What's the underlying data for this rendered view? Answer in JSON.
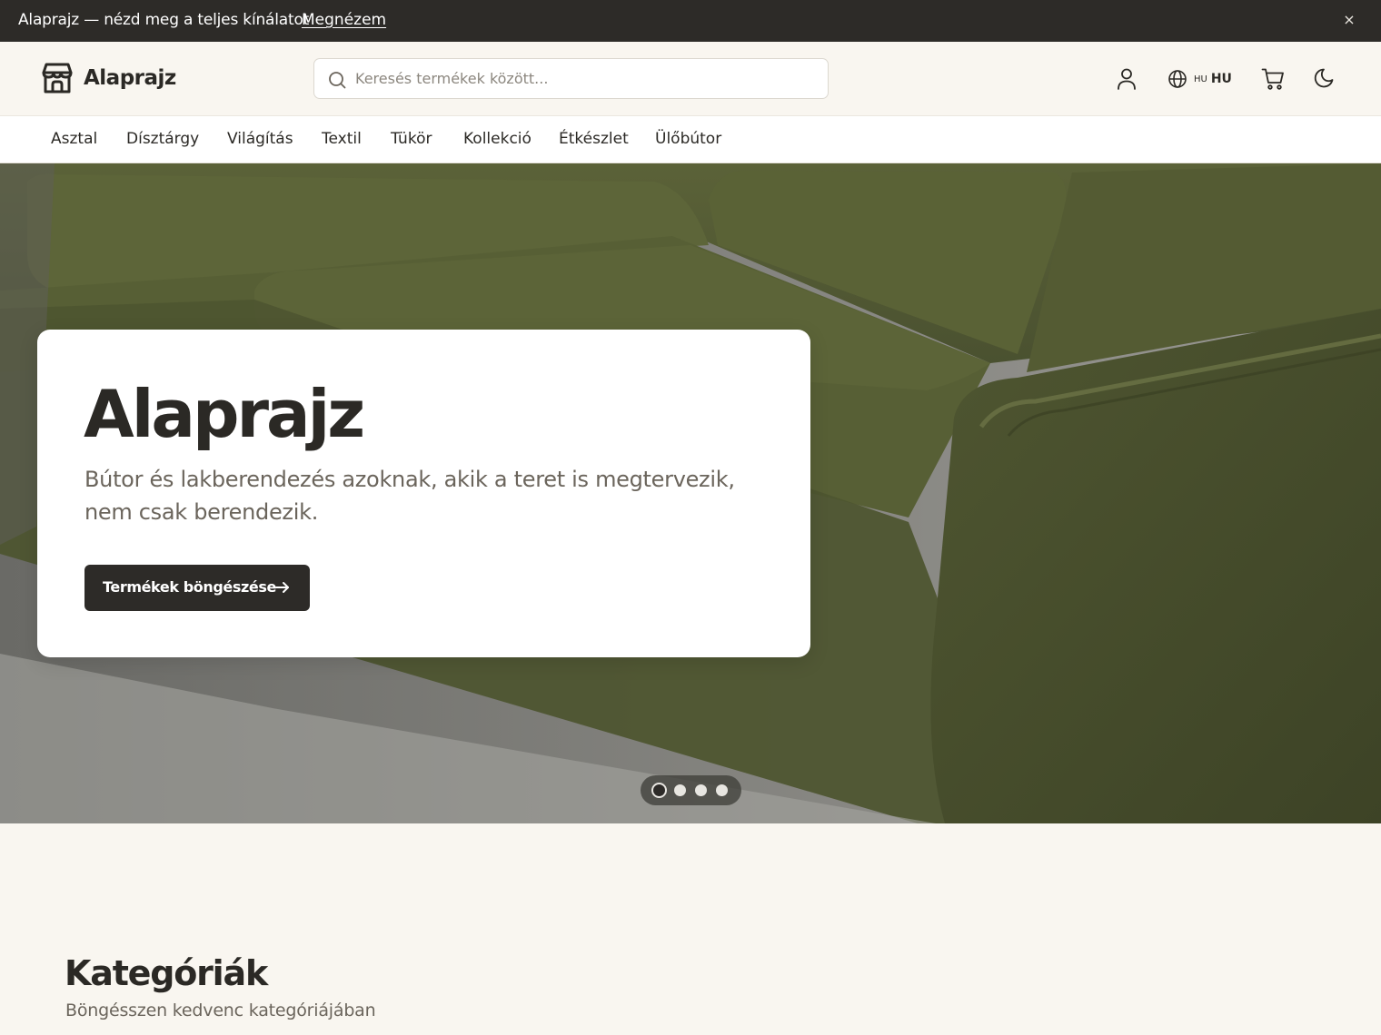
{
  "announcement": {
    "text": "Alaprajz — nézd meg a teljes kínálatot",
    "link_label": "Megnézem",
    "close_label": "×"
  },
  "header": {
    "brand": "Alaprajz",
    "search_placeholder": "Keresés termékek között...",
    "language_small": "HU",
    "language": "HU",
    "icons": [
      "store-icon",
      "search-icon",
      "user-icon",
      "globe-icon",
      "cart-icon",
      "moon-icon"
    ]
  },
  "nav": {
    "items": [
      "Asztal",
      "Dísztárgy",
      "Világítás",
      "Textil",
      "Tükör",
      "Kollekció",
      "Étkészlet",
      "Ülőbútor"
    ]
  },
  "hero": {
    "title": "Alaprajz",
    "subtitle": "Bútor és lakberendezés azoknak, akik a teret is megtervezik, nem csak berendezik.",
    "cta_label": "Termékek böngészése",
    "slides": 4,
    "active_slide": 1
  },
  "categories": {
    "title": "Kategóriák",
    "subtitle": "Böngésszen kedvenc kategóriájában"
  },
  "colors": {
    "dark": "#2d2b28",
    "background": "#f9f6f0",
    "sofa_green": "#4e5633"
  }
}
